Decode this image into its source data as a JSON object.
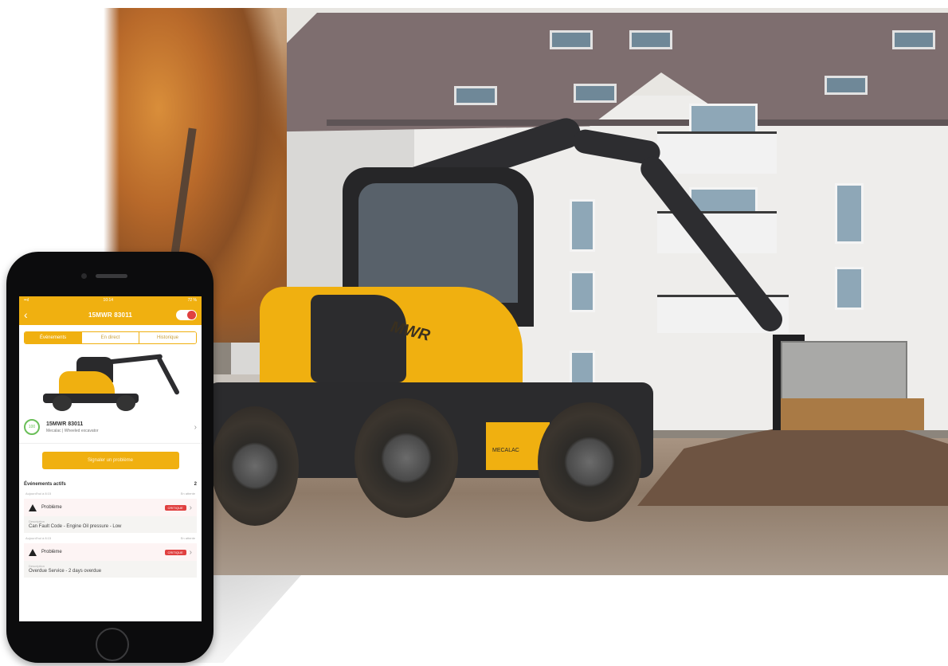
{
  "phone": {
    "status_time": "10:14",
    "status_battery": "72 %",
    "header_title": "15MWR 83011",
    "tabs": [
      {
        "label": "Événements",
        "active": true
      },
      {
        "label": "En direct",
        "active": false
      },
      {
        "label": "Historique",
        "active": false
      }
    ],
    "machine": {
      "id": "15MWR 83011",
      "subtitle": "Mecalac | Wheeled excavator",
      "gauge_label": "100"
    },
    "report_button": "Signaler un problème",
    "active_events": {
      "title": "Événements actifs",
      "count": "2",
      "items": [
        {
          "meta_left": "Aujourd'hui à 8:15",
          "meta_right": "En attente",
          "type": "Problème",
          "badge": "CRITIQUE",
          "desc_label": "Description",
          "desc": "Can Fault Code - Engine Oil pressure - Low"
        },
        {
          "meta_left": "Aujourd'hui à 8:15",
          "meta_right": "En attente",
          "type": "Problème",
          "badge": "CRITIQUE",
          "desc_label": "Description",
          "desc": "Overdue Service - 2 days overdue"
        }
      ]
    }
  },
  "photo": {
    "machine_brand": "MWR",
    "machine_maker": "MECALAC"
  },
  "colors": {
    "accent": "#f0b010",
    "critical": "#e04040",
    "gauge": "#6bbf59"
  }
}
